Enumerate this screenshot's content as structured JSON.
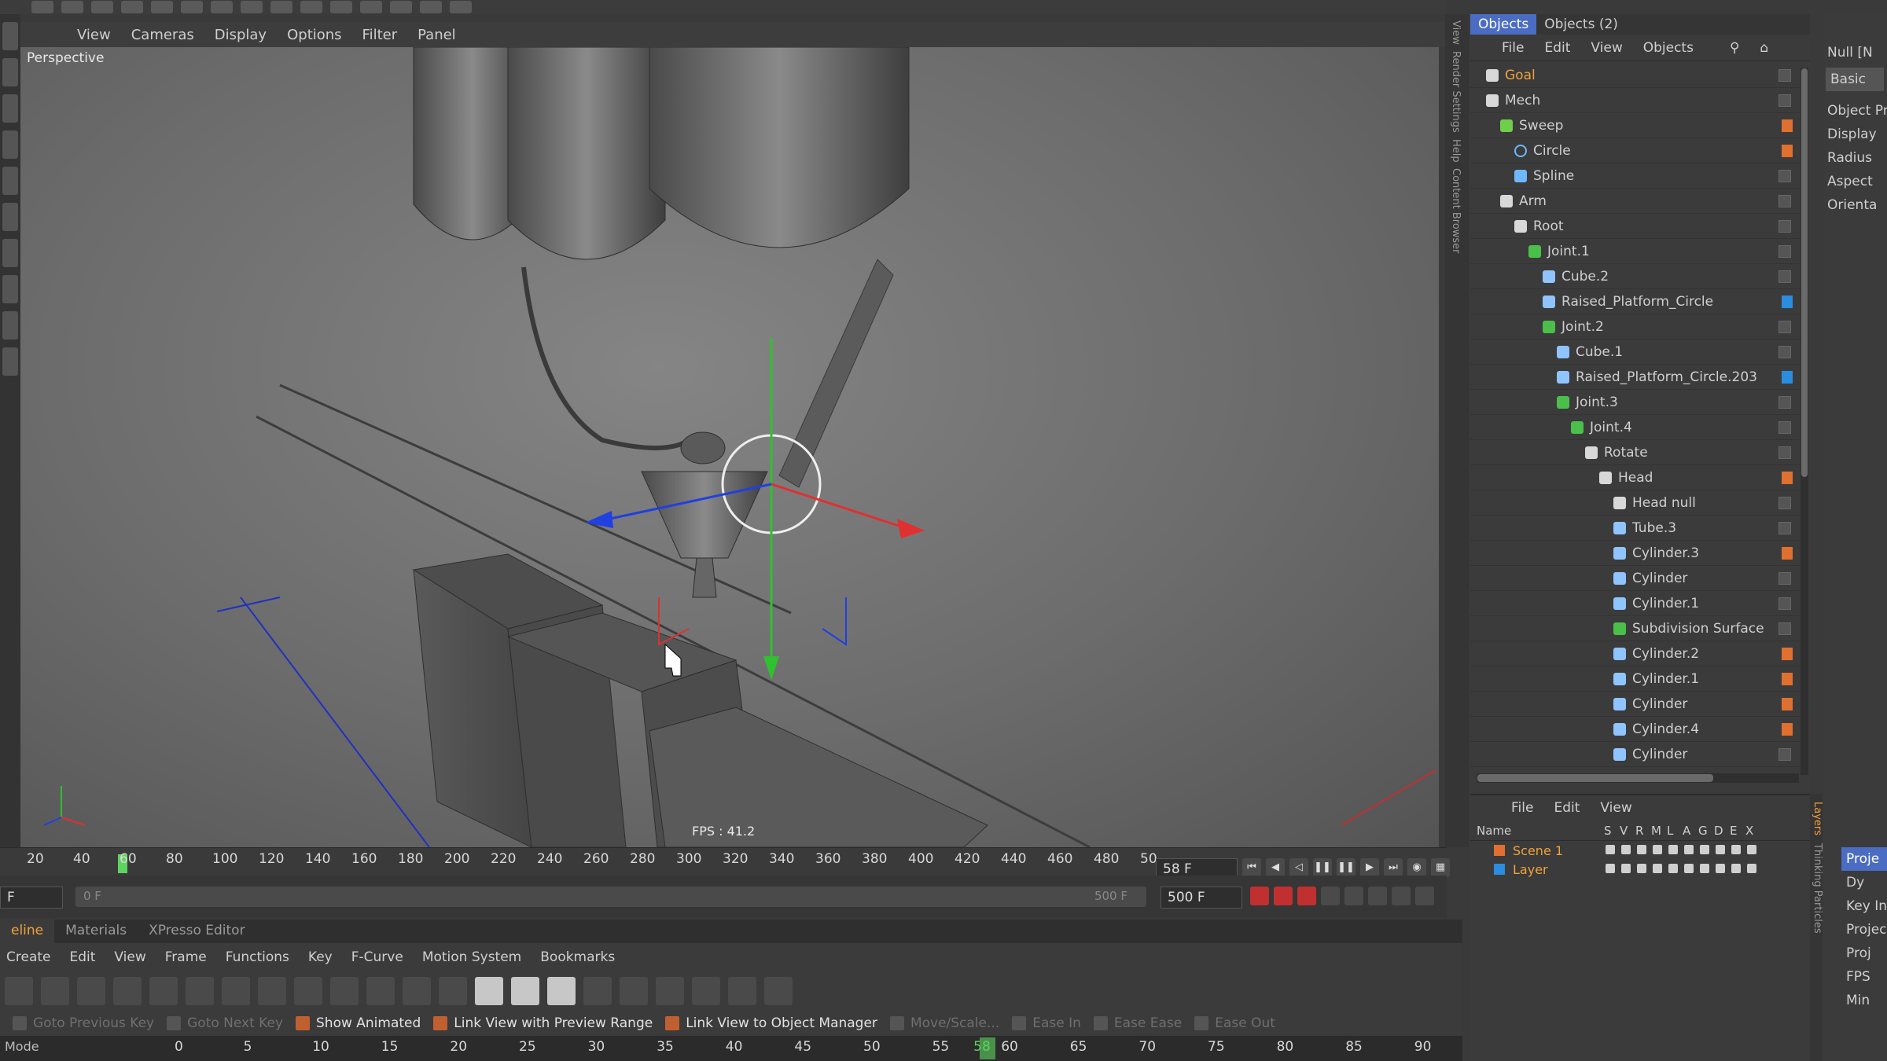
{
  "viewport": {
    "menu": [
      "View",
      "Cameras",
      "Display",
      "Options",
      "Filter",
      "Panel"
    ],
    "camera_label": "Perspective",
    "fps_label": "FPS : 41.2"
  },
  "vertical_tabs": [
    "View",
    "Render Settings",
    "Help",
    "Content Browser"
  ],
  "right_vertical_tabs": [
    "Layers",
    "Thinking Particles"
  ],
  "objects": {
    "tabs": [
      "Objects",
      "Objects (2)"
    ],
    "menu": [
      "File",
      "Edit",
      "View",
      "Objects"
    ],
    "items": [
      {
        "name": "Goal",
        "depth": 0,
        "icon": "null-icon",
        "highlight": "#f0a23a",
        "tag": ""
      },
      {
        "name": "Mech",
        "depth": 0,
        "icon": "null-icon",
        "highlight": "",
        "tag": ""
      },
      {
        "name": "Sweep",
        "depth": 1,
        "icon": "sweep-icon",
        "highlight": "",
        "tag": "#e07030"
      },
      {
        "name": "Circle",
        "depth": 2,
        "icon": "circle-spline-icon",
        "highlight": "",
        "tag": "#e07030"
      },
      {
        "name": "Spline",
        "depth": 2,
        "icon": "spline-icon",
        "highlight": "",
        "tag": ""
      },
      {
        "name": "Arm",
        "depth": 1,
        "icon": "null-icon",
        "highlight": "",
        "tag": ""
      },
      {
        "name": "Root",
        "depth": 2,
        "icon": "null-icon",
        "highlight": "",
        "tag": ""
      },
      {
        "name": "Joint.1",
        "depth": 3,
        "icon": "joint-icon",
        "highlight": "",
        "tag": ""
      },
      {
        "name": "Cube.2",
        "depth": 4,
        "icon": "polygon-icon",
        "highlight": "",
        "tag": ""
      },
      {
        "name": "Raised_Platform_Circle",
        "depth": 4,
        "icon": "polygon-icon",
        "highlight": "",
        "tag": "#2a8de0"
      },
      {
        "name": "Joint.2",
        "depth": 4,
        "icon": "joint-icon",
        "highlight": "",
        "tag": ""
      },
      {
        "name": "Cube.1",
        "depth": 5,
        "icon": "polygon-icon",
        "highlight": "",
        "tag": ""
      },
      {
        "name": "Raised_Platform_Circle.203",
        "depth": 5,
        "icon": "polygon-icon",
        "highlight": "",
        "tag": "#2a8de0"
      },
      {
        "name": "Joint.3",
        "depth": 5,
        "icon": "joint-icon",
        "highlight": "",
        "tag": ""
      },
      {
        "name": "Joint.4",
        "depth": 6,
        "icon": "joint-icon",
        "highlight": "",
        "tag": ""
      },
      {
        "name": "Rotate",
        "depth": 7,
        "icon": "null-icon",
        "highlight": "",
        "tag": ""
      },
      {
        "name": "Head",
        "depth": 8,
        "icon": "null-icon",
        "highlight": "",
        "tag": "#e07030"
      },
      {
        "name": "Head null",
        "depth": 9,
        "icon": "null-icon",
        "highlight": "",
        "tag": ""
      },
      {
        "name": "Tube.3",
        "depth": 9,
        "icon": "tube-icon",
        "highlight": "",
        "tag": ""
      },
      {
        "name": "Cylinder.3",
        "depth": 9,
        "icon": "polygon-icon",
        "highlight": "",
        "tag": "#e07030"
      },
      {
        "name": "Cylinder",
        "depth": 9,
        "icon": "cylinder-icon",
        "highlight": "",
        "tag": ""
      },
      {
        "name": "Cylinder.1",
        "depth": 9,
        "icon": "cylinder-icon",
        "highlight": "",
        "tag": ""
      },
      {
        "name": "Subdivision Surface",
        "depth": 9,
        "icon": "subdivision-icon",
        "highlight": "",
        "tag": ""
      },
      {
        "name": "Cylinder.2",
        "depth": 9,
        "icon": "cylinder-icon",
        "highlight": "",
        "tag": "#e07030"
      },
      {
        "name": "Cylinder.1",
        "depth": 9,
        "icon": "cylinder-icon",
        "highlight": "",
        "tag": "#e07030"
      },
      {
        "name": "Cylinder",
        "depth": 9,
        "icon": "cylinder-icon",
        "highlight": "",
        "tag": "#e07030"
      },
      {
        "name": "Cylinder.4",
        "depth": 9,
        "icon": "cylinder-icon",
        "highlight": "",
        "tag": "#e07030"
      },
      {
        "name": "Cylinder",
        "depth": 9,
        "icon": "cylinder-icon",
        "highlight": "",
        "tag": ""
      }
    ]
  },
  "layers": {
    "menu": [
      "File",
      "Edit",
      "View"
    ],
    "columns": [
      "Name",
      "S",
      "V",
      "R",
      "M",
      "L",
      "A",
      "G",
      "D",
      "E",
      "X"
    ],
    "rows": [
      {
        "name": "Scene 1",
        "color": "#e07030",
        "text_color": "#f0a23a"
      },
      {
        "name": "Layer",
        "color": "#2a8de0",
        "text_color": "#f0a23a"
      }
    ]
  },
  "attributes": {
    "title": "Null [N",
    "tab": "Basic",
    "heading": "Object Pro",
    "fields": [
      "Display",
      "Radius",
      "Aspect",
      "Orienta"
    ],
    "side_labels": [
      "Proje",
      "Dy",
      "Key In",
      "Projec",
      "Proj",
      "FPS",
      "Min"
    ]
  },
  "timeline": {
    "ruler_ticks": [
      "20",
      "40",
      "60",
      "80",
      "100",
      "120",
      "140",
      "160",
      "180",
      "200",
      "220",
      "240",
      "260",
      "280",
      "300",
      "320",
      "340",
      "360",
      "380",
      "400",
      "420",
      "440",
      "460",
      "480",
      "50"
    ],
    "current_frame": "58 F",
    "end_frame": "500 F",
    "range_start": "0 F",
    "range_end": "500 F",
    "left_field": "F"
  },
  "bottom": {
    "tabs": [
      "eline",
      "Materials",
      "XPresso Editor"
    ],
    "menu": [
      "Create",
      "Edit",
      "View",
      "Frame",
      "Functions",
      "Key",
      "F-Curve",
      "Motion System",
      "Bookmarks"
    ],
    "options": [
      {
        "label": "Goto Previous Key",
        "on": false
      },
      {
        "label": "Goto Next Key",
        "on": false
      },
      {
        "label": "Show Animated",
        "on": true
      },
      {
        "label": "Link View with Preview Range",
        "on": true
      },
      {
        "label": "Link View to Object Manager",
        "on": true
      },
      {
        "label": "Move/Scale...",
        "on": false
      },
      {
        "label": "Ease In",
        "on": false
      },
      {
        "label": "Ease Ease",
        "on": false
      },
      {
        "label": "Ease Out",
        "on": false
      }
    ],
    "ruler_ticks": [
      "0",
      "5",
      "10",
      "15",
      "20",
      "25",
      "30",
      "35",
      "40",
      "45",
      "50",
      "55",
      "58",
      "60",
      "65",
      "70",
      "75",
      "80",
      "85",
      "90"
    ],
    "mode_label": "Mode"
  },
  "colors": {
    "accent": "#4a6cc2",
    "x_axis": "#e03030",
    "y_axis": "#30c030",
    "z_axis": "#2040e0",
    "orange": "#f0a23a"
  }
}
